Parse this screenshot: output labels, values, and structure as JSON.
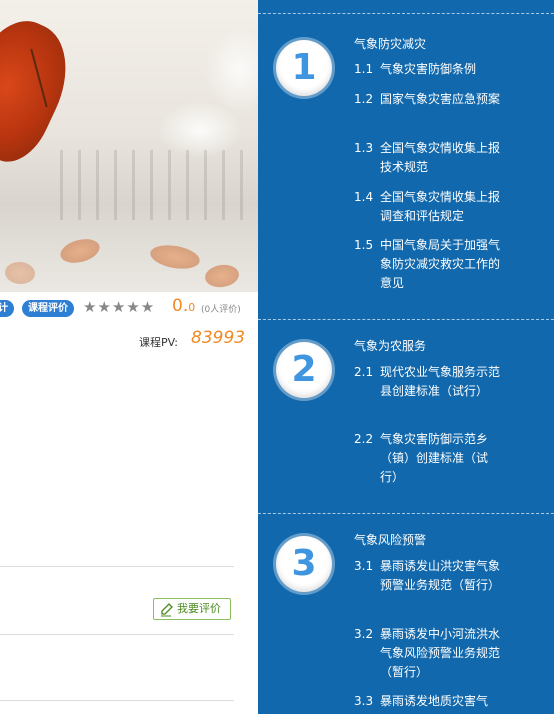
{
  "course": {
    "tag1": "计",
    "tag2": "课程评价",
    "stars": "★★★★★",
    "score_main": "0.",
    "score_small": "0",
    "rating_count": "(0人评价)",
    "pv_label": "课程PV:",
    "pv_value": "83993",
    "evaluate_button": "我要评价"
  },
  "sections": [
    {
      "number": "1",
      "title": "气象防灾减灾",
      "items": [
        {
          "num": "1.1",
          "text": "气象灾害防御条例"
        },
        {
          "num": "1.2",
          "text": "国家气象灾害应急预案"
        },
        {
          "num": "1.3",
          "text": "全国气象灾情收集上报技术规范"
        },
        {
          "num": "1.4",
          "text": "全国气象灾情收集上报调查和评估规定"
        },
        {
          "num": "1.5",
          "text": "中国气象局关于加强气象防灾减灾救灾工作的意见"
        }
      ]
    },
    {
      "number": "2",
      "title": "气象为农服务",
      "items": [
        {
          "num": "2.1",
          "text": "现代农业气象服务示范县创建标准（试行）"
        },
        {
          "num": "2.2",
          "text": "气象灾害防御示范乡（镇）创建标准（试行）"
        }
      ]
    },
    {
      "number": "3",
      "title": "气象风险预警",
      "items": [
        {
          "num": "3.1",
          "text": "暴雨诱发山洪灾害气象预警业务规范（暂行）"
        },
        {
          "num": "3.2",
          "text": "暴雨诱发中小河流洪水气象风险预警业务规范（暂行）"
        },
        {
          "num": "3.3",
          "text": "暴雨诱发地质灾害气"
        }
      ]
    }
  ]
}
